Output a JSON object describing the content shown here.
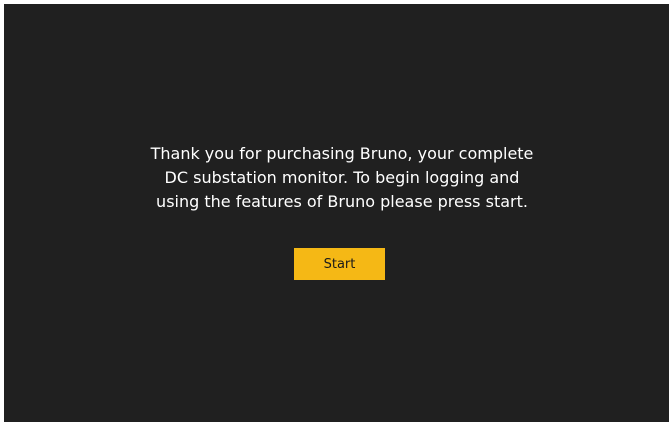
{
  "welcome": {
    "lines": [
      "Thank you for purchasing Bruno, your complete",
      "DC substation monitor. To begin logging and",
      "using the features of Bruno please press start."
    ]
  },
  "start_button": {
    "label": "Start"
  },
  "colors": {
    "background": "#202020",
    "accent": "#f5b815",
    "text": "#ffffff"
  }
}
